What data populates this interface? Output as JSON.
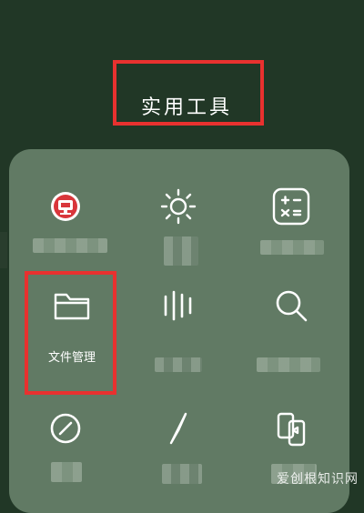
{
  "screen_title": "实用工具",
  "tools": [
    {
      "id": "browser",
      "label": "",
      "icon": "browser-logo-icon"
    },
    {
      "id": "brightness",
      "label": "",
      "icon": "sun-icon"
    },
    {
      "id": "calculator",
      "label": "",
      "icon": "calculator-icon"
    },
    {
      "id": "file-manager",
      "label": "文件管理",
      "icon": "folder-icon"
    },
    {
      "id": "sound-recorder",
      "label": "",
      "icon": "sound-bars-icon"
    },
    {
      "id": "search",
      "label": "",
      "icon": "search-icon"
    },
    {
      "id": "clock",
      "label": "",
      "icon": "clock-icon"
    },
    {
      "id": "compass",
      "label": "",
      "icon": "compass-icon"
    },
    {
      "id": "phone-clone",
      "label": "",
      "icon": "phone-transfer-icon"
    }
  ],
  "watermark": "爱创根知识网",
  "colors": {
    "background": "#213726",
    "panel": "#617a64",
    "highlight": "#e8312f",
    "icon_fg": "#ffffff"
  }
}
